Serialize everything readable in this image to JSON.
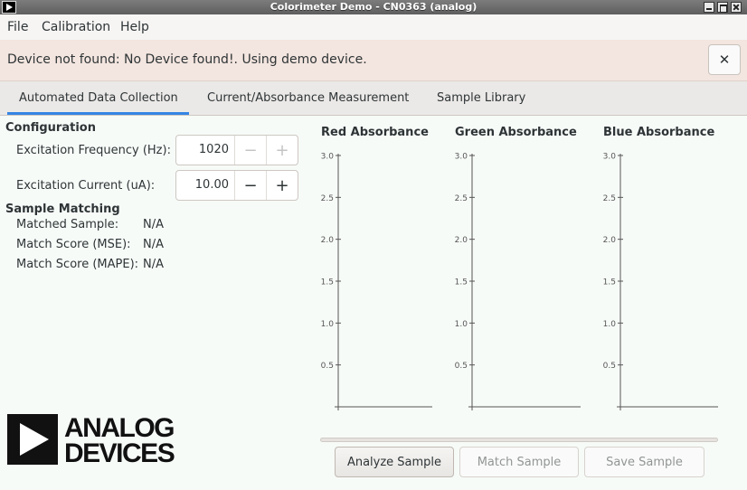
{
  "window": {
    "title": "Colorimeter Demo - CN0363 (analog)"
  },
  "menu": [
    "File",
    "Calibration",
    "Help"
  ],
  "infobar": {
    "message": "Device not found: No Device found!. Using demo device.",
    "close_glyph": "✕"
  },
  "tabs": [
    {
      "label": "Automated Data Collection",
      "active": true
    },
    {
      "label": "Current/Absorbance Measurement",
      "active": false
    },
    {
      "label": "Sample Library",
      "active": false
    }
  ],
  "configuration": {
    "title": "Configuration",
    "frequency": {
      "label": "Excitation Frequency (Hz):",
      "value": "1020",
      "minus": "−",
      "plus": "+"
    },
    "current": {
      "label": "Excitation Current (uA):",
      "value": "10.00",
      "minus": "−",
      "plus": "+"
    }
  },
  "sample_matching": {
    "title": "Sample Matching",
    "rows": [
      {
        "label": "Matched Sample:",
        "value": "N/A"
      },
      {
        "label": "Match Score (MSE):",
        "value": "N/A"
      },
      {
        "label": "Match Score (MAPE):",
        "value": "N/A"
      }
    ]
  },
  "chart_data": [
    {
      "type": "bar",
      "title": "Red Absorbance",
      "ylim": [
        0,
        3.0
      ],
      "yticks": [
        "0.5",
        "1.0",
        "1.5",
        "2.0",
        "2.5",
        "3.0"
      ],
      "values": []
    },
    {
      "type": "bar",
      "title": "Green Absorbance",
      "ylim": [
        0,
        3.0
      ],
      "yticks": [
        "0.5",
        "1.0",
        "1.5",
        "2.0",
        "2.5",
        "3.0"
      ],
      "values": []
    },
    {
      "type": "bar",
      "title": "Blue Absorbance",
      "ylim": [
        0,
        3.0
      ],
      "yticks": [
        "0.5",
        "1.0",
        "1.5",
        "2.0",
        "2.5",
        "3.0"
      ],
      "values": []
    }
  ],
  "logo": {
    "line1": "ANALOG",
    "line2": "DEVICES"
  },
  "progress": {
    "fraction": 0
  },
  "actions": {
    "analyze": "Analyze Sample",
    "match": "Match Sample",
    "save": "Save Sample"
  },
  "colors": {
    "accent": "#3584e4",
    "infobar": "#f3e5df"
  }
}
